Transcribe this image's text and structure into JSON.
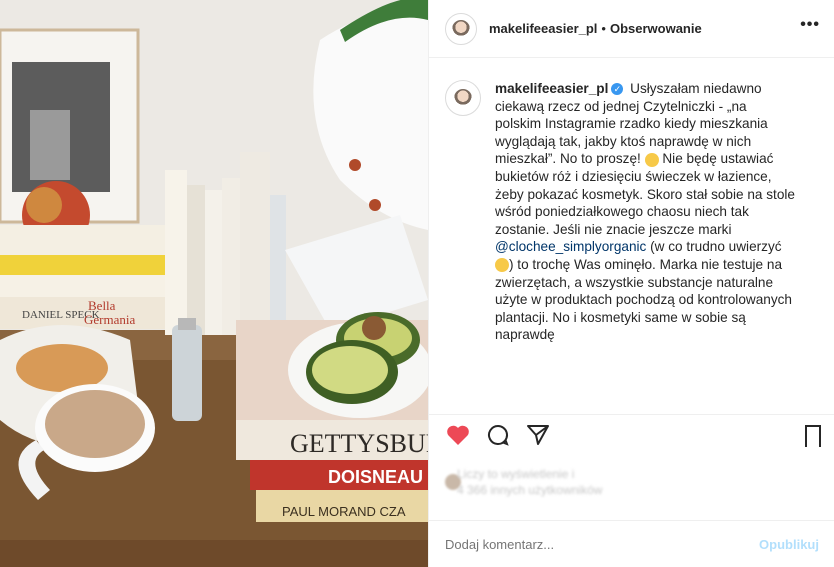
{
  "header": {
    "username": "makelifeeasier_pl",
    "separator": "•",
    "follow_label": "Obserwowanie",
    "more_label": "•••"
  },
  "caption": {
    "username": "makelifeeasier_pl",
    "verified_glyph": "✓",
    "text_1": " Usłyszałam niedawno ciekawą rzecz od jednej Czytelniczki - „na polskim Instagramie rzadko kiedy mieszkania wyglądają tak, jakby ktoś naprawdę w nich mieszkał”. No to proszę! ",
    "text_2": " Nie będę ustawiać bukietów róż i dziesięciu świeczek w łazience, żeby pokazać kosmetyk. Skoro stał sobie na stole wśród poniedziałkowego chaosu niech tak zostanie. Jeśli nie znacie jeszcze marki ",
    "mention": "@clochee_simplyorganic",
    "text_3": " (w co trudno uwierzyć ",
    "text_4": ") to trochę Was ominęło. Marka nie testuje na zwierzętach, a wszystkie substancje naturalne użyte w produktach pochodzą od kontrolowanych plantacji. No i kosmetyki same w sobie są naprawdę"
  },
  "likes": {
    "line1": "Liczy to wyświetlenie i",
    "line2": "4 366 innych użytkowników"
  },
  "comment": {
    "placeholder": "Dodaj komentarz...",
    "publish_label": "Opublikuj"
  },
  "icons": {
    "like": "heart-icon",
    "comment": "comment-icon",
    "share": "share-icon",
    "save": "bookmark-icon"
  },
  "colors": {
    "like_red": "#ed4956",
    "link_blue": "#003569",
    "publish_disabled": "#b2dffc",
    "verified_blue": "#3897f0"
  }
}
